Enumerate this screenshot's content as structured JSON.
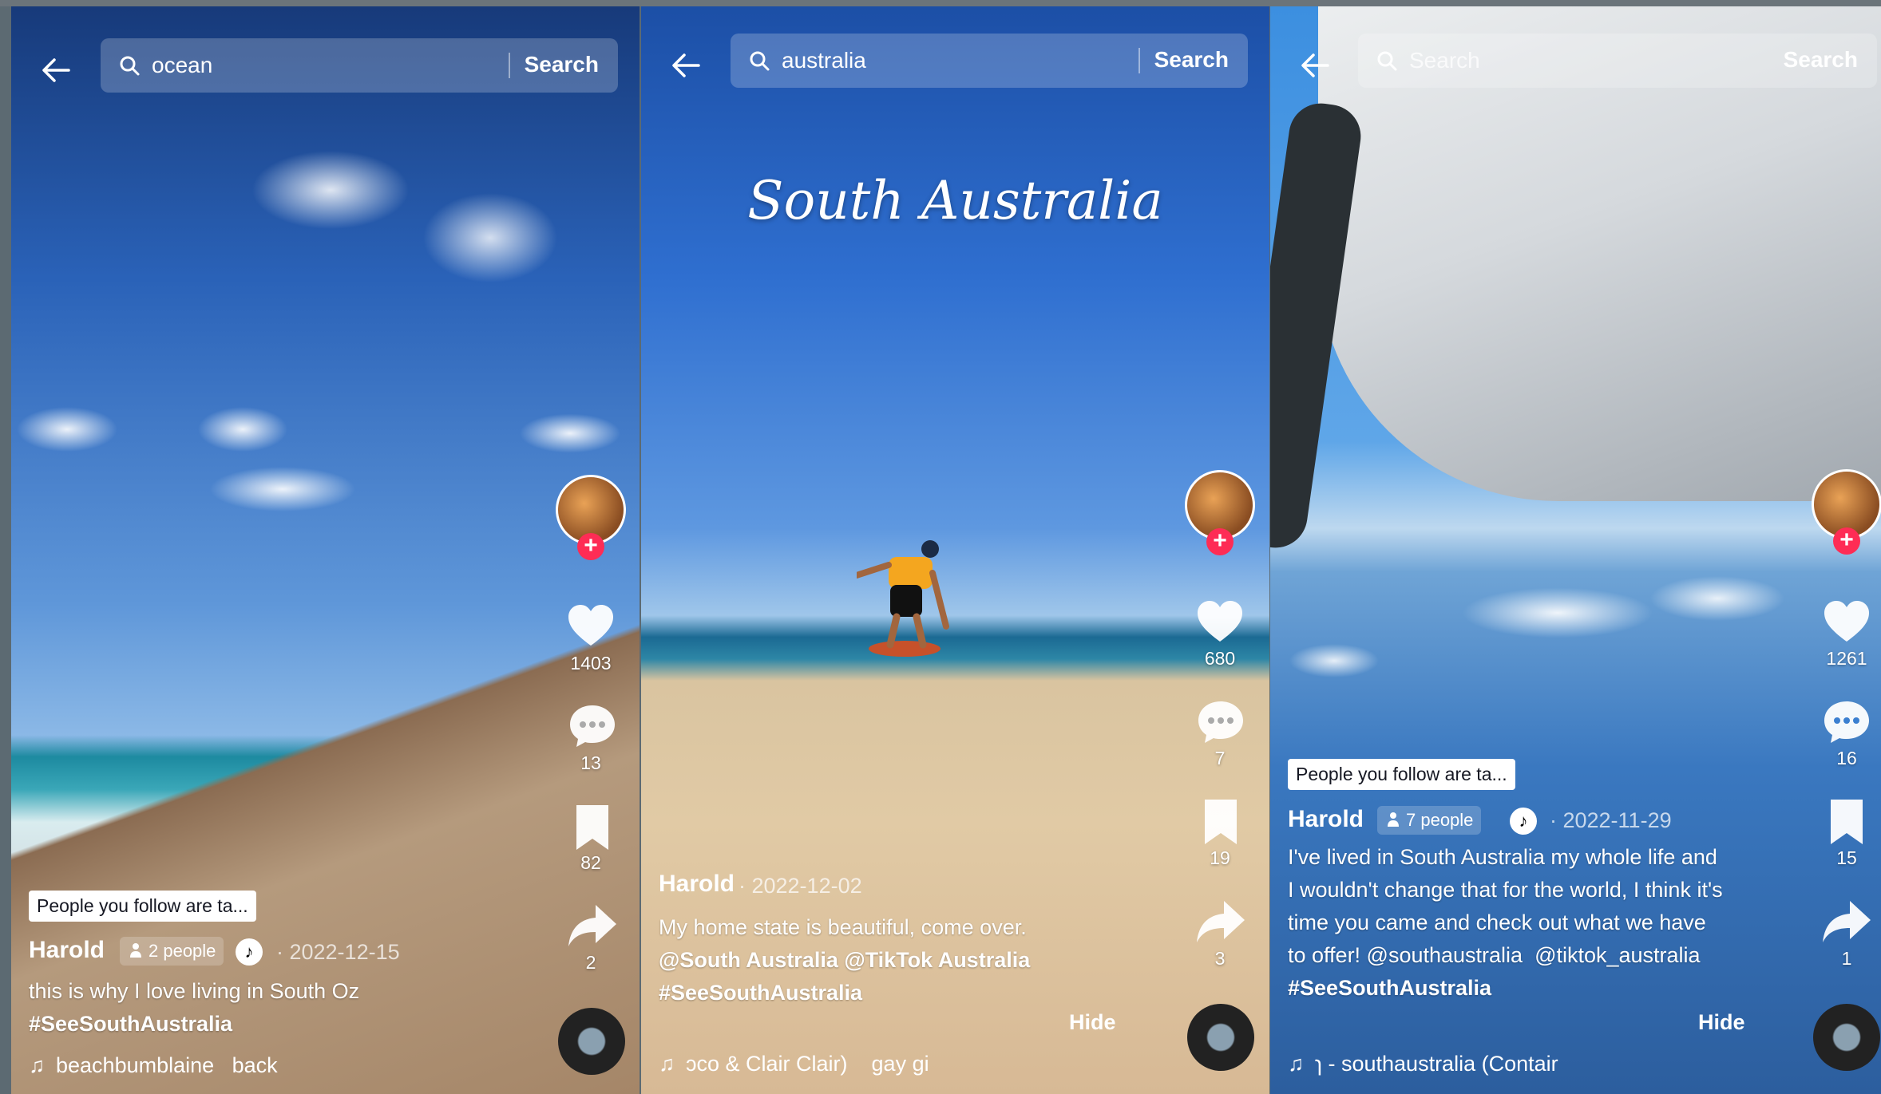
{
  "panels": [
    {
      "search": {
        "query": "ocean",
        "button": "Search"
      },
      "rail": {
        "likes": "1403",
        "comments": "13",
        "saves": "82",
        "shares": "2"
      },
      "pill": "People you follow are ta...",
      "author": "Harold",
      "people": "2 people",
      "tiktok_badge": "♪",
      "date": "· 2022-12-15",
      "caption": [
        "this is why I love living in South Oz",
        "#SeeSouthAustralia"
      ],
      "music": "beachbumblaine   back"
    },
    {
      "search": {
        "query": "australia",
        "button": "Search"
      },
      "overlay_title": "South Australia",
      "rail": {
        "likes": "680",
        "comments": "7",
        "saves": "19",
        "shares": "3"
      },
      "author": "Harold",
      "date": "· 2022-12-02",
      "caption": [
        "My home state is beautiful, come over.",
        "@South Australia @TikTok Australia",
        "#SeeSouthAustralia"
      ],
      "hide": "Hide",
      "music": "ɔco & Clair Clair)    gay gi"
    },
    {
      "search": {
        "placeholder": "Search",
        "button": "Search"
      },
      "rail": {
        "likes": "1261",
        "comments": "16",
        "saves": "15",
        "shares": "1"
      },
      "pill": "People you follow are ta...",
      "author": "Harold",
      "people": "7 people",
      "tiktok_badge": "♪",
      "date": "· 2022-11-29",
      "caption": [
        "I've lived in South Australia my whole life and",
        "I wouldn't change that for the world, I think it's",
        "time you came and check out what we have",
        "to offer! @southaustralia  @tiktok_australia",
        "#SeeSouthAustralia"
      ],
      "hide": "Hide",
      "music": "ɿ - southaustralia (Contair"
    }
  ],
  "icons": {
    "back": "back-arrow-icon",
    "search": "search-icon",
    "like": "heart-icon",
    "comment": "comment-icon",
    "save": "bookmark-icon",
    "share": "share-icon",
    "music": "music-note-icon",
    "follow": "plus-icon"
  },
  "colors": {
    "accent": "#fe2c55",
    "pill_bg": "#ffffff",
    "text": "#ffffff"
  }
}
